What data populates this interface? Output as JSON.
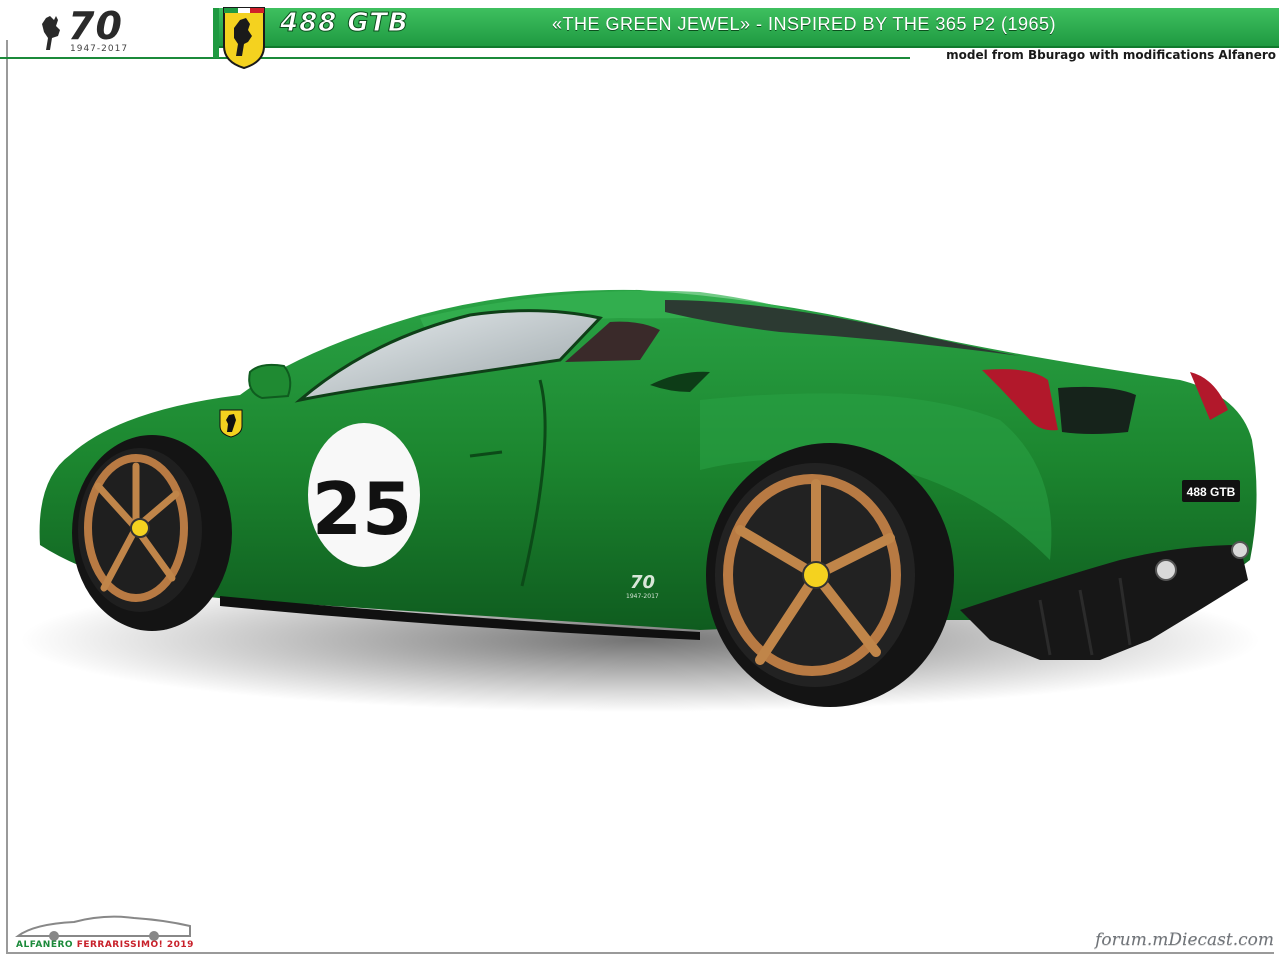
{
  "header": {
    "anniversary_number": "70",
    "anniversary_years": "1947-2017",
    "model_name": "488 GTB",
    "subtitle": "«THE GREEN JEWEL»  -  INSPIRED BY THE 365 P2  (1965)",
    "credits": "model from Bburago with modifications Alfanero"
  },
  "car": {
    "race_number": "25",
    "rear_badge": "488 GTB",
    "side_badge_number": "70",
    "side_badge_years": "1947-2017"
  },
  "footer": {
    "author_sig_1": "ALFANERO",
    "author_sig_2": "FERRARISSIMO! 2019",
    "watermark": "forum.mDiecast.com"
  },
  "colors": {
    "banner_green": "#1f9a41",
    "body_green": "#1c7f2e",
    "wheel_bronze": "#b87a43",
    "ferrari_yellow": "#f4d21f"
  }
}
